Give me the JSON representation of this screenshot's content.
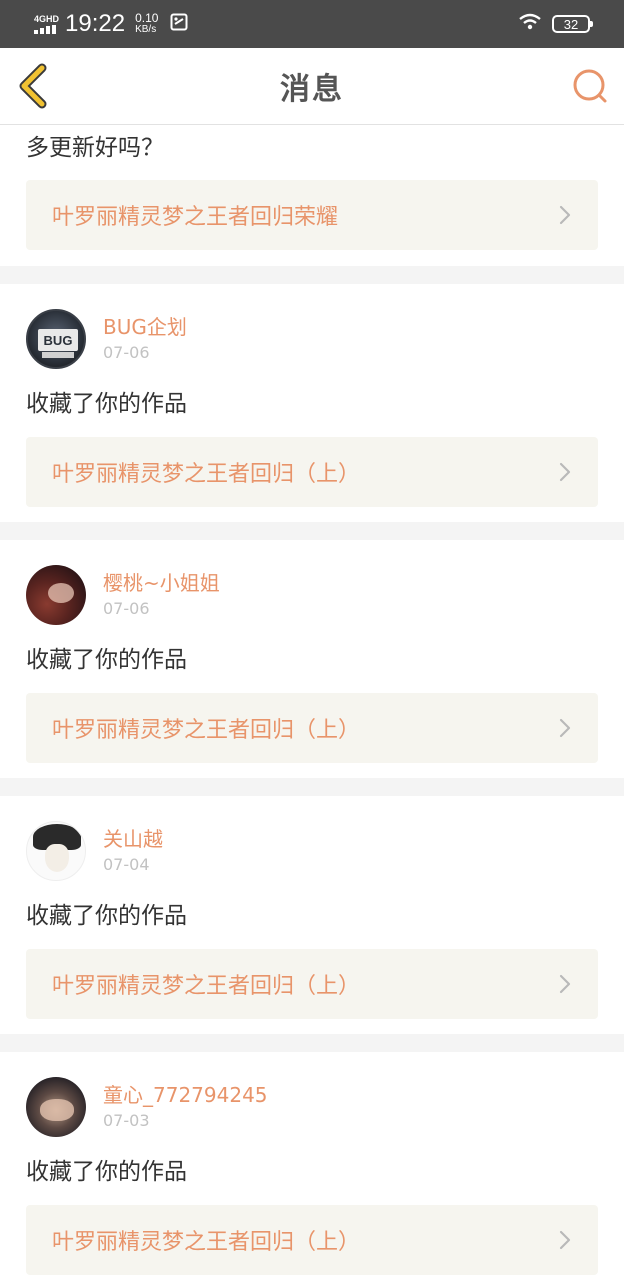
{
  "status_bar": {
    "network": "4GHD",
    "time": "19:22",
    "speed_value": "0.10",
    "speed_unit": "KB/s",
    "battery": "32"
  },
  "header": {
    "title": "消息"
  },
  "partial_card": {
    "text": "多更新好吗？",
    "work_title": "叶罗丽精灵梦之王者回归荣耀"
  },
  "messages": [
    {
      "user": "BUG企划",
      "date": "07-06",
      "text": "收藏了你的作品",
      "work_title": "叶罗丽精灵梦之王者回归（上）",
      "avatar_badge": "BUG"
    },
    {
      "user": "樱桃~小姐姐",
      "date": "07-06",
      "text": "收藏了你的作品",
      "work_title": "叶罗丽精灵梦之王者回归（上）"
    },
    {
      "user": "关山越",
      "date": "07-04",
      "text": "收藏了你的作品",
      "work_title": "叶罗丽精灵梦之王者回归（上）"
    },
    {
      "user": "童心_772794245",
      "date": "07-03",
      "text": "收藏了你的作品",
      "work_title": "叶罗丽精灵梦之王者回归（上）"
    }
  ],
  "colors": {
    "accent": "#e8946a",
    "back_icon": "#f1c232",
    "status_bar_bg": "#4a4a4a",
    "link_bg": "#f6f5ef"
  },
  "icons": {
    "back": "chevron-left-icon",
    "search": "search-icon",
    "link_arrow": "chevron-right-icon"
  }
}
